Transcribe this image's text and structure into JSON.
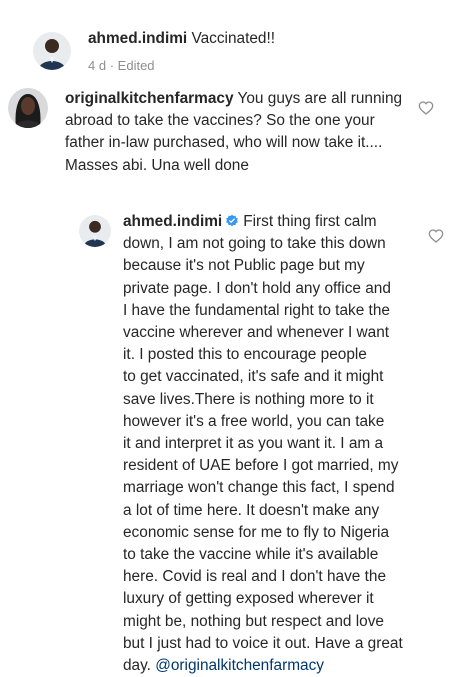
{
  "comments": [
    {
      "username": "ahmed.indimi",
      "text": "Vaccinated!!",
      "time": "4 d",
      "edited": "Edited",
      "separator": "·"
    },
    {
      "username": "originalkitchenfarmacy",
      "text_lines": [
        "You guys are all running",
        "abroad to take the vaccines? So the one your",
        "father in-law purchased, who will now take it....",
        "Masses abi. Una well done"
      ]
    },
    {
      "username": "ahmed.indimi",
      "first_line": "First thing first calm",
      "text_lines": [
        "down, I am not going to take this down",
        "because it's not Public page but my",
        "private page. I don't hold any office and",
        "I have the fundamental right to take the",
        "vaccine wherever and whenever  I want",
        "it. I posted this to encourage people",
        "to get vaccinated, it's safe and it might",
        "save lives.There is nothing more to it",
        "however it's a free world, you can take",
        "it and interpret it as you want it. I am a",
        "resident of UAE before I got married, my",
        "marriage won't change this fact, I spend",
        "a lot of time here. It doesn't make any",
        "economic sense for me to fly to Nigeria",
        "to take the vaccine while it's available",
        "here. Covid is real and I don't have the",
        "luxury of getting exposed wherever it",
        "might be, nothing but respect and love",
        "but I just had to voice it out. Have a great",
        "day."
      ],
      "mention": "@originalkitchenfarmacy"
    }
  ],
  "icons": {
    "like": "heart-icon",
    "verified": "verified-badge-icon"
  },
  "colors": {
    "text": "#262626",
    "meta": "#8e8e8e",
    "mention": "#00376b",
    "verified": "#3897f0"
  }
}
